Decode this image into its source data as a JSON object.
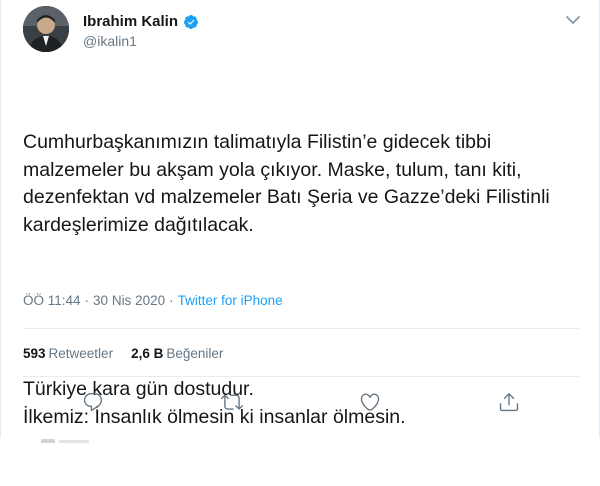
{
  "author": {
    "display_name": "Ibrahim Kalin",
    "handle": "@ikalin1",
    "verified": true
  },
  "tweet": {
    "paragraph1": "Cumhurbaşkanımızın talimatıyla Filistin’e gidecek tibbi malzemeler bu akşam yola çıkıyor. Maske, tulum, tanı kiti, dezenfektan vd malzemeler Batı Şeria ve Gazze’deki Filistinli kardeşlerimize dağıtılacak.",
    "paragraph2": "Türkiye kara gün dostudur.\nİlkemiz: İnsanlık ölmesin ki insanlar ölmesin."
  },
  "meta": {
    "time": "ÖÖ 11:44",
    "separator": "·",
    "date": "30 Nis 2020",
    "source": "Twitter for iPhone"
  },
  "stats": {
    "retweets_count": "593",
    "retweets_label": "Retweetler",
    "likes_count": "2,6 B",
    "likes_label": "Beğeniler"
  },
  "colors": {
    "accent": "#1da1f2",
    "text": "#14171a",
    "secondary": "#657786",
    "divider": "#e6ecf0"
  },
  "icons": {
    "reply": "reply-icon",
    "retweet": "retweet-icon",
    "like": "like-icon",
    "share": "share-icon",
    "more": "chevron-down-icon",
    "verified": "verified-badge-icon"
  }
}
